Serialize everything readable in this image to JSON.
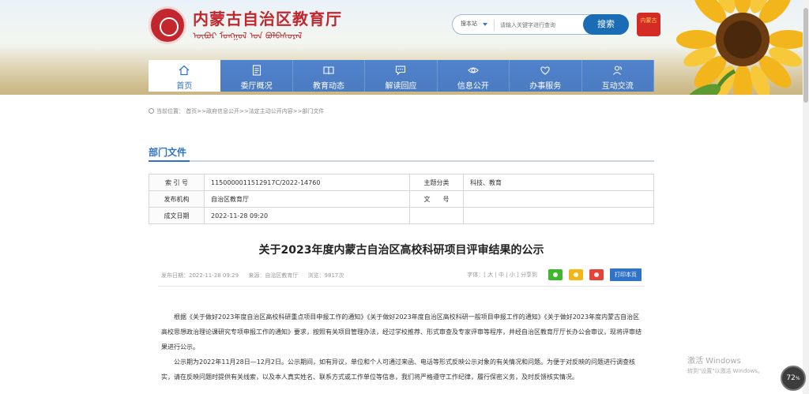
{
  "header": {
    "site_title": "内蒙古自治区教育厅",
    "site_subtitle": "ᠦᠪᠦᠷ ᠮᠣᠩᠭᠣᠯ ᠤᠨ ᠪᠣᠯᠪᠠᠰᠤᠷᠠᠯ",
    "search": {
      "scope": "搜本站",
      "placeholder": "请输入关键字进行查询",
      "button": "搜索"
    },
    "seal_text": "内蒙古"
  },
  "nav": [
    {
      "label": "首页",
      "icon": "home-icon",
      "active": true
    },
    {
      "label": "委厅概况",
      "icon": "document-icon",
      "active": false
    },
    {
      "label": "教育动态",
      "icon": "book-icon",
      "active": false
    },
    {
      "label": "解读回应",
      "icon": "chat-icon",
      "active": false
    },
    {
      "label": "信息公开",
      "icon": "eye-icon",
      "active": false
    },
    {
      "label": "办事服务",
      "icon": "service-icon",
      "active": false
    },
    {
      "label": "互动交流",
      "icon": "people-icon",
      "active": false
    }
  ],
  "breadcrumb": {
    "prefix": "当前位置：",
    "path": "首页>>政府信息公开>>法定主动公开内容>>部门文件"
  },
  "section_title": "部门文件",
  "meta_table": {
    "rows": [
      {
        "k1": "索 引 号",
        "v1": "1150000011512917C/2022-14760",
        "k2": "主题分类",
        "v2": "科技、教育"
      },
      {
        "k1": "发布机构",
        "v1": "自治区教育厅",
        "k2": "文　　号",
        "v2": ""
      },
      {
        "k1": "成文日期",
        "v1": "2022-11-28 09:20",
        "k2": "",
        "v2": ""
      }
    ]
  },
  "article": {
    "title": "关于2023年度内蒙古自治区高校科研项目评审结果的公示",
    "publish_date": "发布日期：2022-11-28 09:29",
    "source": "来源：自治区教育厅",
    "views": "浏览：9817次",
    "font_size_label": "字体：[ 大 | 中 | 小 ] 分享到",
    "print_label": "打印本页",
    "paragraphs": [
      "根据《关于做好2023年度自治区高校科研重点项目申报工作的通知》《关于做好2023年度自治区高校科研一般项目申报工作的通知》《关于做好2023年度内蒙古自治区高校思想政治理论课研究专项申报工作的通知》要求，按照有关项目管理办法，经过学校推荐、形式审查及专家评审等程序，并经自治区教育厅厅长办公会审议，现将评审结果进行公示。",
      "公示期为2022年11月28日—12月2日。公示期间，如有异议，单位和个人可通过来函、电话等形式反映公示对象的有关情况和问题。为便于对反映的问题进行调查核实，请在反映问题时提供有关线索，以及本人真实姓名、联系方式或工作单位等信息，我们将严格遵守工作纪律，履行保密义务，及时反馈核实情况。"
    ]
  },
  "activation": {
    "line1": "激活 Windows",
    "line2": "转到\"设置\"以激活 Windows。"
  },
  "zoom": "72"
}
